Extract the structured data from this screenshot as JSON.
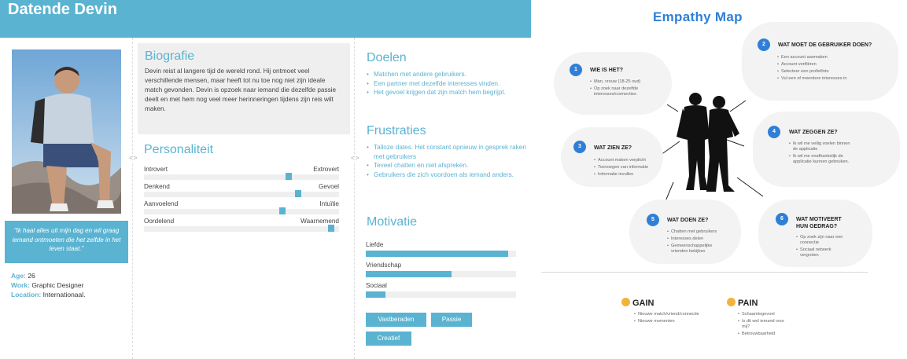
{
  "persona": {
    "name": "Datende Devin",
    "quote": "\"Ik haal alles uit mijn dag en wil graag iemand ontmoeten die het zelfde in het leven staat.\"",
    "facts": [
      {
        "key": "Age:",
        "value": "26"
      },
      {
        "key": "Work:",
        "value": "Graphic Designer"
      },
      {
        "key": "Location:",
        "value": "Internationaal."
      }
    ],
    "bio": {
      "title": "Biografie",
      "text": "Devin reist al langere tijd de wereld rond. Hij ontmoet veel verschillende mensen, maar heeft tot nu toe nog niet zijn ideale match gevonden. Devin is opzoek naar iemand die dezelfde passie deelt en met hem nog veel meer herinneringen tijdens zijn reis wilt maken."
    },
    "personality": {
      "title": "Personaliteit",
      "rows": [
        {
          "left": "Introvert",
          "right": "Extrovert",
          "value": 0.74
        },
        {
          "left": "Denkend",
          "right": "Gevoel",
          "value": 0.79
        },
        {
          "left": "Aanvoelend",
          "right": "Intuïtie",
          "value": 0.71
        },
        {
          "left": "Oordelend",
          "right": "Waarnemend",
          "value": 0.96
        }
      ]
    },
    "goals": {
      "title": "Doelen",
      "items": [
        "Matchen met andere gebruikers.",
        "Een partner met dezelfde interesses vinden.",
        "Het gevoel krijgen dat zijn match hem begrijpt."
      ]
    },
    "frustrations": {
      "title": "Frustraties",
      "items": [
        "Talloze dates. Het constant opnieuw in gesprek raken met gebruikers",
        "Teveel chatten en niet afspreken.",
        "Gebruikers die zich voordoen als iemand anders."
      ]
    },
    "motivation": {
      "title": "Motivatie",
      "items": [
        {
          "label": "Liefde",
          "value": 0.95
        },
        {
          "label": "Vriendschap",
          "value": 0.57
        },
        {
          "label": "Sociaal",
          "value": 0.13
        }
      ]
    },
    "tags": [
      "Vastberaden",
      "Passie",
      "Creatief"
    ]
  },
  "empathy": {
    "title": "Empathy Map",
    "sections": [
      {
        "num": "1",
        "question": "WIE IS HET?",
        "items": [
          "Man, vrouw (18-25 oud)",
          "Op zoek naar dezelfde interesses/connecties"
        ]
      },
      {
        "num": "2",
        "question": "WAT MOET DE GEBRUIKER DOEN?",
        "items": [
          "Een account aanmaken",
          "Account verifiëren",
          "Selecteer een profielfoto",
          "Vul een of meerdere interesses in"
        ]
      },
      {
        "num": "3",
        "question": "WAT ZIEN ZE?",
        "items": [
          "Account maken verplicht",
          "Toevoegen van informatie",
          "Informatie invullen"
        ]
      },
      {
        "num": "4",
        "question": "WAT ZEGGEN ZE?",
        "items": [
          "Ik wil me veilig voelen binnen de applicatie",
          "Ik wil me onafhankelijk de applicatie kunnen gebruiken."
        ]
      },
      {
        "num": "5",
        "question": "WAT DOEN ZE?",
        "items": [
          "Chatten met gebruikers",
          "Interesses delen",
          "Gemeenschappelijke vrienden bekijken"
        ]
      },
      {
        "num": "6",
        "question": "WAT MOTIVEERT HUN GEDRAG?",
        "items": [
          "Op zoek zijn naar een connectie",
          "Sociaal netwerk vergroten"
        ]
      }
    ],
    "gain": {
      "title": "GAIN",
      "items": [
        "Nieuwe match/vriend/connectie",
        "Nieuwe momenten"
      ]
    },
    "pain": {
      "title": "PAIN",
      "items": [
        "Schaamtegevoel",
        "Is dit wel iemand voor mij?",
        "Betrouwbaarheid"
      ]
    }
  }
}
